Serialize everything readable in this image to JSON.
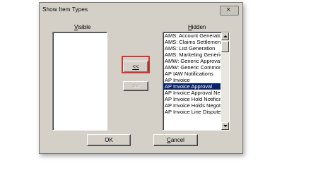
{
  "window": {
    "title": "Show Item Types",
    "close_glyph": "×"
  },
  "visible_column": {
    "header_underlined": "V",
    "header_rest": "isible"
  },
  "hidden_column": {
    "header_underlined": "H",
    "header_rest": "idden",
    "items": [
      "AMS: Account Generato",
      "AMS: Claims Settlement",
      "AMS: List Generation",
      "AMS: Marketing Generic",
      "AMW: Generic Approval",
      "AMW: Generic Common",
      "AP IAW Notifications",
      "AP Invoice",
      "AP Invoice Approval",
      "AP Invoice Approval Ne",
      "AP Invoice Hold Notifica",
      "AP Invoice Holds Negot",
      "AP Invoice Line Dispute"
    ],
    "selected_index": 8
  },
  "buttons": {
    "move_left_underlined": "<<",
    "move_right": ">>",
    "ok": "OK",
    "cancel_underlined": "C",
    "cancel_rest": "ancel"
  },
  "colors": {
    "dialog_bg": "#d4d0c8",
    "selection_bg": "#0a246a",
    "highlight_border": "#e03030"
  },
  "icons": {
    "scroll_up": "up-arrow-icon",
    "scroll_down": "down-arrow-icon",
    "close": "close-icon"
  }
}
